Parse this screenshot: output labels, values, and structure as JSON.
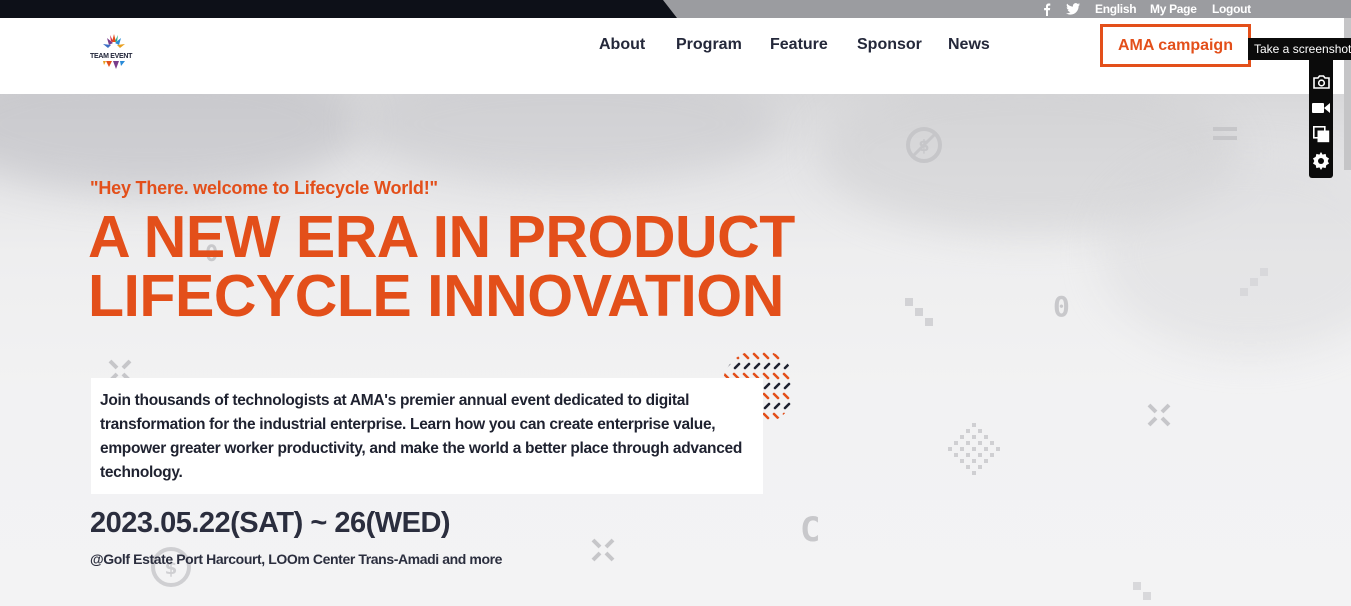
{
  "utility_bar": {
    "language": "English",
    "my_page": "My Page",
    "logout": "Logout",
    "social": [
      "facebook-icon",
      "twitter-icon"
    ]
  },
  "header": {
    "logo_text": "TEAM EVENT",
    "nav": [
      "About",
      "Program",
      "Feature",
      "Sponsor",
      "News"
    ],
    "cta_label": "AMA campaign"
  },
  "screenshot_widget": {
    "tooltip": "Take a screenshot",
    "tools": [
      "camera-icon",
      "video-icon",
      "copy-icon",
      "settings-icon"
    ]
  },
  "hero": {
    "tagline": "\"Hey There. welcome to Lifecycle World!\"",
    "headline_line1": "A NEW ERA IN PRODUCT",
    "headline_line2": "LIFECYCLE INNOVATION",
    "description": "Join thousands of technologists at AMA's premier annual event dedicated to digital transformation for the industrial enterprise. Learn how you can create enterprise value, empower greater worker productivity, and make the world a better place through advanced technology.",
    "date": "2023.05.22(SAT) ~ 26(WED)",
    "venue": "@Golf Estate Port Harcourt, LOOm Center Trans-Amadi and more"
  },
  "colors": {
    "accent": "#e34f1a",
    "topbar_dark": "#0d1018",
    "topbar_gray": "#9b9ca0",
    "text_dark": "#24283a"
  }
}
